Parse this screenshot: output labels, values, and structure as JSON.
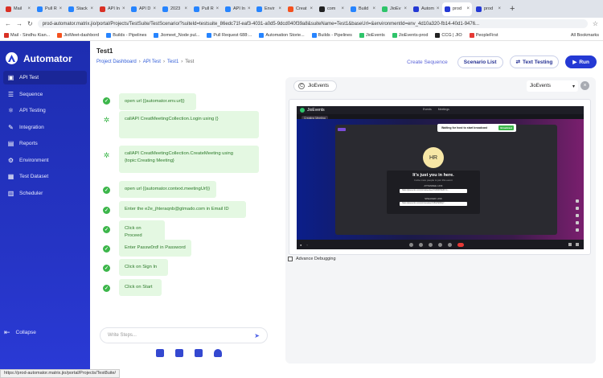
{
  "browser": {
    "tabs": [
      {
        "label": "Mail",
        "color": "#d93025",
        "active": false
      },
      {
        "label": "Pull R",
        "color": "#2684ff",
        "active": false
      },
      {
        "label": "Stack",
        "color": "#2684ff",
        "active": false
      },
      {
        "label": "API In",
        "color": "#d93025",
        "active": false
      },
      {
        "label": "API D",
        "color": "#2684ff",
        "active": false
      },
      {
        "label": "2023",
        "color": "#2684ff",
        "active": false
      },
      {
        "label": "Pull R",
        "color": "#2684ff",
        "active": false
      },
      {
        "label": "API In",
        "color": "#2684ff",
        "active": false
      },
      {
        "label": "Envir",
        "color": "#2684ff",
        "active": false
      },
      {
        "label": "Creat",
        "color": "#f4511e",
        "active": false
      },
      {
        "label": "com",
        "color": "#222222",
        "active": false
      },
      {
        "label": "Build",
        "color": "#2684ff",
        "active": false
      },
      {
        "label": "JioEv",
        "color": "#2ec46a",
        "active": false
      },
      {
        "label": "Autom",
        "color": "#2439d4",
        "active": false
      },
      {
        "label": "prod",
        "color": "#2439d4",
        "active": true
      },
      {
        "label": "prod",
        "color": "#2439d4",
        "active": false
      }
    ],
    "new_tab": "+",
    "url": "prod-automator.matrix.jio/portal/Projects/TestSuite/TestScenario/?suiteId=testsuite_86edc71f-eaf3-4031-a0d5-9dcd040f39a8&suiteName=Test1&baseUrl=&environmentId=env_4d10a320-fb14-40d1-9476...",
    "bookmarks": [
      {
        "label": "Mail - Sindhu Kian...",
        "color": "#d93025"
      },
      {
        "label": "JioMeet-dashbord",
        "color": "#f4511e"
      },
      {
        "label": "Builds - Pipelines",
        "color": "#2684ff"
      },
      {
        "label": "Jiomeet_Node pul...",
        "color": "#2684ff"
      },
      {
        "label": "Pull Request 688:...",
        "color": "#2684ff"
      },
      {
        "label": "Automation Storie...",
        "color": "#2684ff"
      },
      {
        "label": "Builds - Pipelines",
        "color": "#2684ff"
      },
      {
        "label": "JioEvents",
        "color": "#2ec46a"
      },
      {
        "label": "JioEvents-prod",
        "color": "#2ec46a"
      },
      {
        "label": "CCG | JIO",
        "color": "#222222"
      },
      {
        "label": "PeopleFirst",
        "color": "#e53935"
      }
    ],
    "all_bookmarks": "All Bookmarks",
    "status_url": "https://prod-automator.matrix.jio/portal/Projects/Test8uite/"
  },
  "sidebar": {
    "app_name": "Automator",
    "items": [
      {
        "label": "API Test",
        "icon": "api-test-icon",
        "active": true
      },
      {
        "label": "Sequence",
        "icon": "sequence-icon",
        "active": false
      },
      {
        "label": "API Testing",
        "icon": "api-testing-icon",
        "active": false
      },
      {
        "label": "Integration",
        "icon": "integration-icon",
        "active": false
      },
      {
        "label": "Reports",
        "icon": "reports-icon",
        "active": false
      },
      {
        "label": "Environment",
        "icon": "environment-icon",
        "active": false
      },
      {
        "label": "Test Dataset",
        "icon": "dataset-icon",
        "active": false
      },
      {
        "label": "Scheduler",
        "icon": "scheduler-icon",
        "active": false
      }
    ],
    "collapse_label": "Collapse"
  },
  "header": {
    "title": "Test1",
    "breadcrumb": [
      "Project Dashboard",
      "API Test",
      "Test1",
      "Test"
    ],
    "create_sequence": "Create Sequence",
    "scenario_list": "Scenario List",
    "text_testing": "Text Testing",
    "run": "Run"
  },
  "steps": [
    {
      "text": "open url {{automator.env.url}}",
      "icon": "check-icon"
    },
    {
      "text": "callAPI CreatMeetingCollection.Login using {}",
      "icon": "gear-icon"
    },
    {
      "text": "callAPI CreatMeetingCollection.CreateMeeting using {topic:Creating Meeting}",
      "icon": "gear-icon"
    },
    {
      "text": "open url {{automator.context.meetingUrl}}",
      "icon": "check-icon"
    },
    {
      "text": "Enter the e2e_jhteraqnb@gtmado.com in Email ID",
      "icon": "check-icon"
    },
    {
      "text": "Click on Proceed",
      "icon": "check-icon"
    },
    {
      "text": "Enter Passw0rd! in Password",
      "icon": "check-icon"
    },
    {
      "text": "Click on Sign In",
      "icon": "check-icon"
    },
    {
      "text": "Click on Start",
      "icon": "check-icon"
    }
  ],
  "input": {
    "placeholder": "Write Steps..."
  },
  "preview": {
    "tab_label": "JioEvents",
    "env_label": "JioEvents",
    "advance_debugging": "Advance Debugging",
    "inner": {
      "brand": "JioEvents",
      "tabs": [
        "Events",
        "Meetings"
      ],
      "meeting_chip": "Creating Meeting",
      "notice": "Waiting for host to start broadcast",
      "notice_btn": "Broadcast",
      "avatar": "HR",
      "heading": "It's just you in here.",
      "sub": "Invite more people to join this event",
      "attendee_label": "ATTENDEE LINK",
      "attendee_link": "https://jioevents.com/join/attendee/r0UNRP4EPL7e...",
      "speaker_label": "SPEAKER LINK",
      "speaker_link": "https://jioevents.com/join/speaker/f1f6d7EfMQY..."
    }
  }
}
